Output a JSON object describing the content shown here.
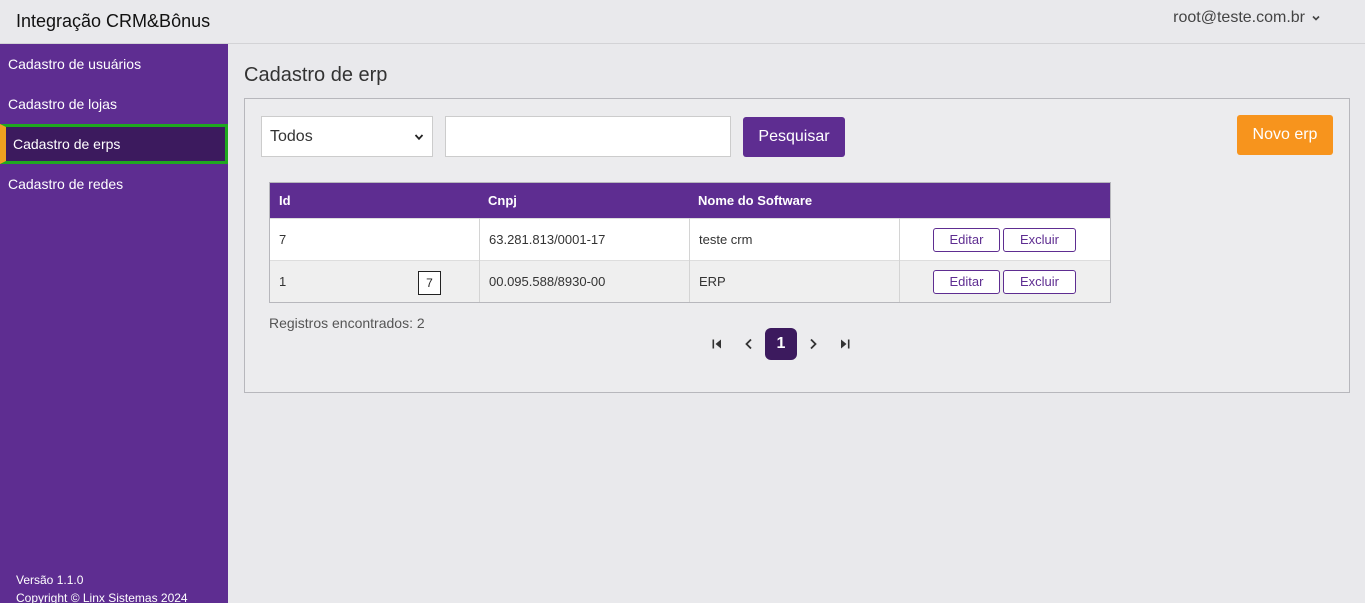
{
  "header": {
    "app_title": "Integração CRM&Bônus",
    "user": "root@teste.com.br",
    "user_menu_icon": "chevron-down-icon"
  },
  "sidebar": {
    "items": [
      {
        "label": "Cadastro de usuários",
        "active": false
      },
      {
        "label": "Cadastro de lojas",
        "active": false
      },
      {
        "label": "Cadastro de erps",
        "active": true
      },
      {
        "label": "Cadastro de redes",
        "active": false
      }
    ],
    "version": "Versão 1.1.0",
    "copyright": "Copyright © Linx Sistemas 2024"
  },
  "main": {
    "title": "Cadastro de erp",
    "filter": {
      "selected": "Todos"
    },
    "search": {
      "value": "",
      "placeholder": ""
    },
    "search_button": "Pesquisar",
    "new_button": "Novo erp",
    "table": {
      "columns": [
        "Id",
        "Cnpj",
        "Nome do Software"
      ],
      "rows": [
        {
          "id": "7",
          "cnpj": "63.281.813/0001-17",
          "name": "teste crm",
          "edit": "Editar",
          "delete": "Excluir"
        },
        {
          "id": "1",
          "cnpj": "00.095.588/8930-00",
          "name": "ERP",
          "edit": "Editar",
          "delete": "Excluir"
        }
      ],
      "tooltip": "7"
    },
    "records": "Registros encontrados: 2",
    "pagination": {
      "current": "1"
    }
  },
  "colors": {
    "primary": "#5e2d91",
    "primary_dark": "#3c1a5e",
    "accent": "#f7941d",
    "active_border": "#1fa81f"
  }
}
